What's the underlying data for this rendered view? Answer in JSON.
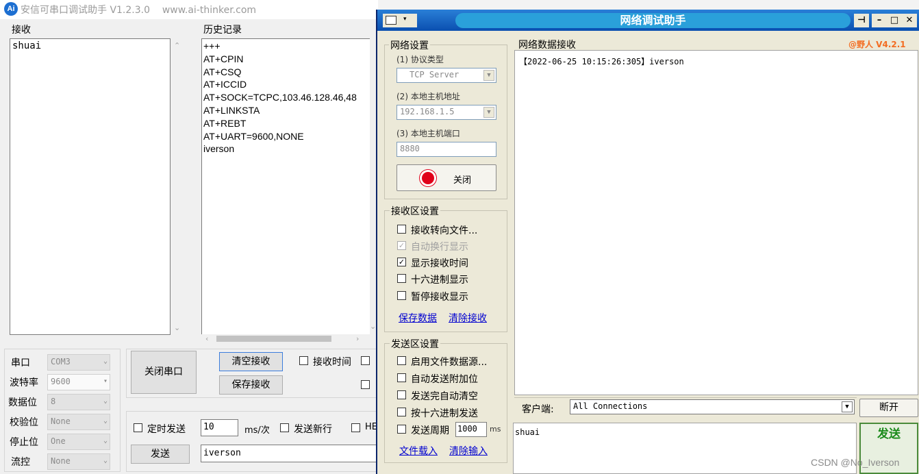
{
  "left_app": {
    "title": "安信可串口调试助手 V1.2.3.0",
    "site": "www.ai-thinker.com",
    "logo": "Ai",
    "receive": {
      "label": "接收",
      "content": "shuai"
    },
    "history": {
      "label": "历史记录",
      "items": [
        "+++",
        "AT+CPIN",
        "AT+CSQ",
        "AT+ICCID",
        "AT+SOCK=TCPC,103.46.128.46,48",
        "AT+LINKSTA",
        "AT+REBT",
        "AT+UART=9600,NONE",
        "iverson"
      ]
    },
    "serial": {
      "port_label": "串口",
      "port_value": "COM3",
      "baud_label": "波特率",
      "baud_value": "9600",
      "databits_label": "数据位",
      "databits_value": "8",
      "parity_label": "校验位",
      "parity_value": "None",
      "stopbits_label": "停止位",
      "stopbits_value": "One",
      "flow_label": "流控",
      "flow_value": "None"
    },
    "buttons": {
      "close_port": "关闭串口",
      "clear_receive": "清空接收",
      "save_receive": "保存接收",
      "send": "发送"
    },
    "options": {
      "receive_time": "接收时间",
      "timed_send": "定时发送",
      "interval_value": "10",
      "interval_unit": "ms/次",
      "send_newline": "发送新行",
      "hex_cut": "HE"
    },
    "send_input": "iverson"
  },
  "right_app": {
    "title": "网络调试助手",
    "net_settings": {
      "title": "网络设置",
      "protocol_label": "(1) 协议类型",
      "protocol_value": "TCP Server",
      "host_label": "(2) 本地主机地址",
      "host_value": "192.168.1.5",
      "port_label": "(3) 本地主机端口",
      "port_value": "8880",
      "close_button": "关闭"
    },
    "recv_settings": {
      "title": "接收区设置",
      "options": [
        {
          "label": "接收转向文件...",
          "checked": false,
          "disabled": false
        },
        {
          "label": "自动换行显示",
          "checked": true,
          "disabled": true
        },
        {
          "label": "显示接收时间",
          "checked": true,
          "disabled": false
        },
        {
          "label": "十六进制显示",
          "checked": false,
          "disabled": false
        },
        {
          "label": "暂停接收显示",
          "checked": false,
          "disabled": false
        }
      ],
      "save_link": "保存数据",
      "clear_link": "清除接收"
    },
    "send_settings": {
      "title": "发送区设置",
      "options": [
        {
          "label": "启用文件数据源...",
          "checked": false
        },
        {
          "label": "自动发送附加位",
          "checked": false
        },
        {
          "label": "发送完自动清空",
          "checked": false
        },
        {
          "label": "按十六进制发送",
          "checked": false
        }
      ],
      "period_label": "发送周期",
      "period_value": "1000",
      "period_unit": "ms",
      "load_link": "文件载入",
      "clear_link": "清除输入"
    },
    "recv_area": {
      "title": "网络数据接收",
      "brand": "@野人  V4.2.1",
      "line": "【2022-06-25 10:15:26:305】iverson"
    },
    "client": {
      "label": "客户端:",
      "value": "All Connections",
      "disconnect": "断开"
    },
    "send_area": {
      "content": "shuai",
      "send_button": "发送"
    }
  },
  "watermark": "CSDN @No_Iverson"
}
